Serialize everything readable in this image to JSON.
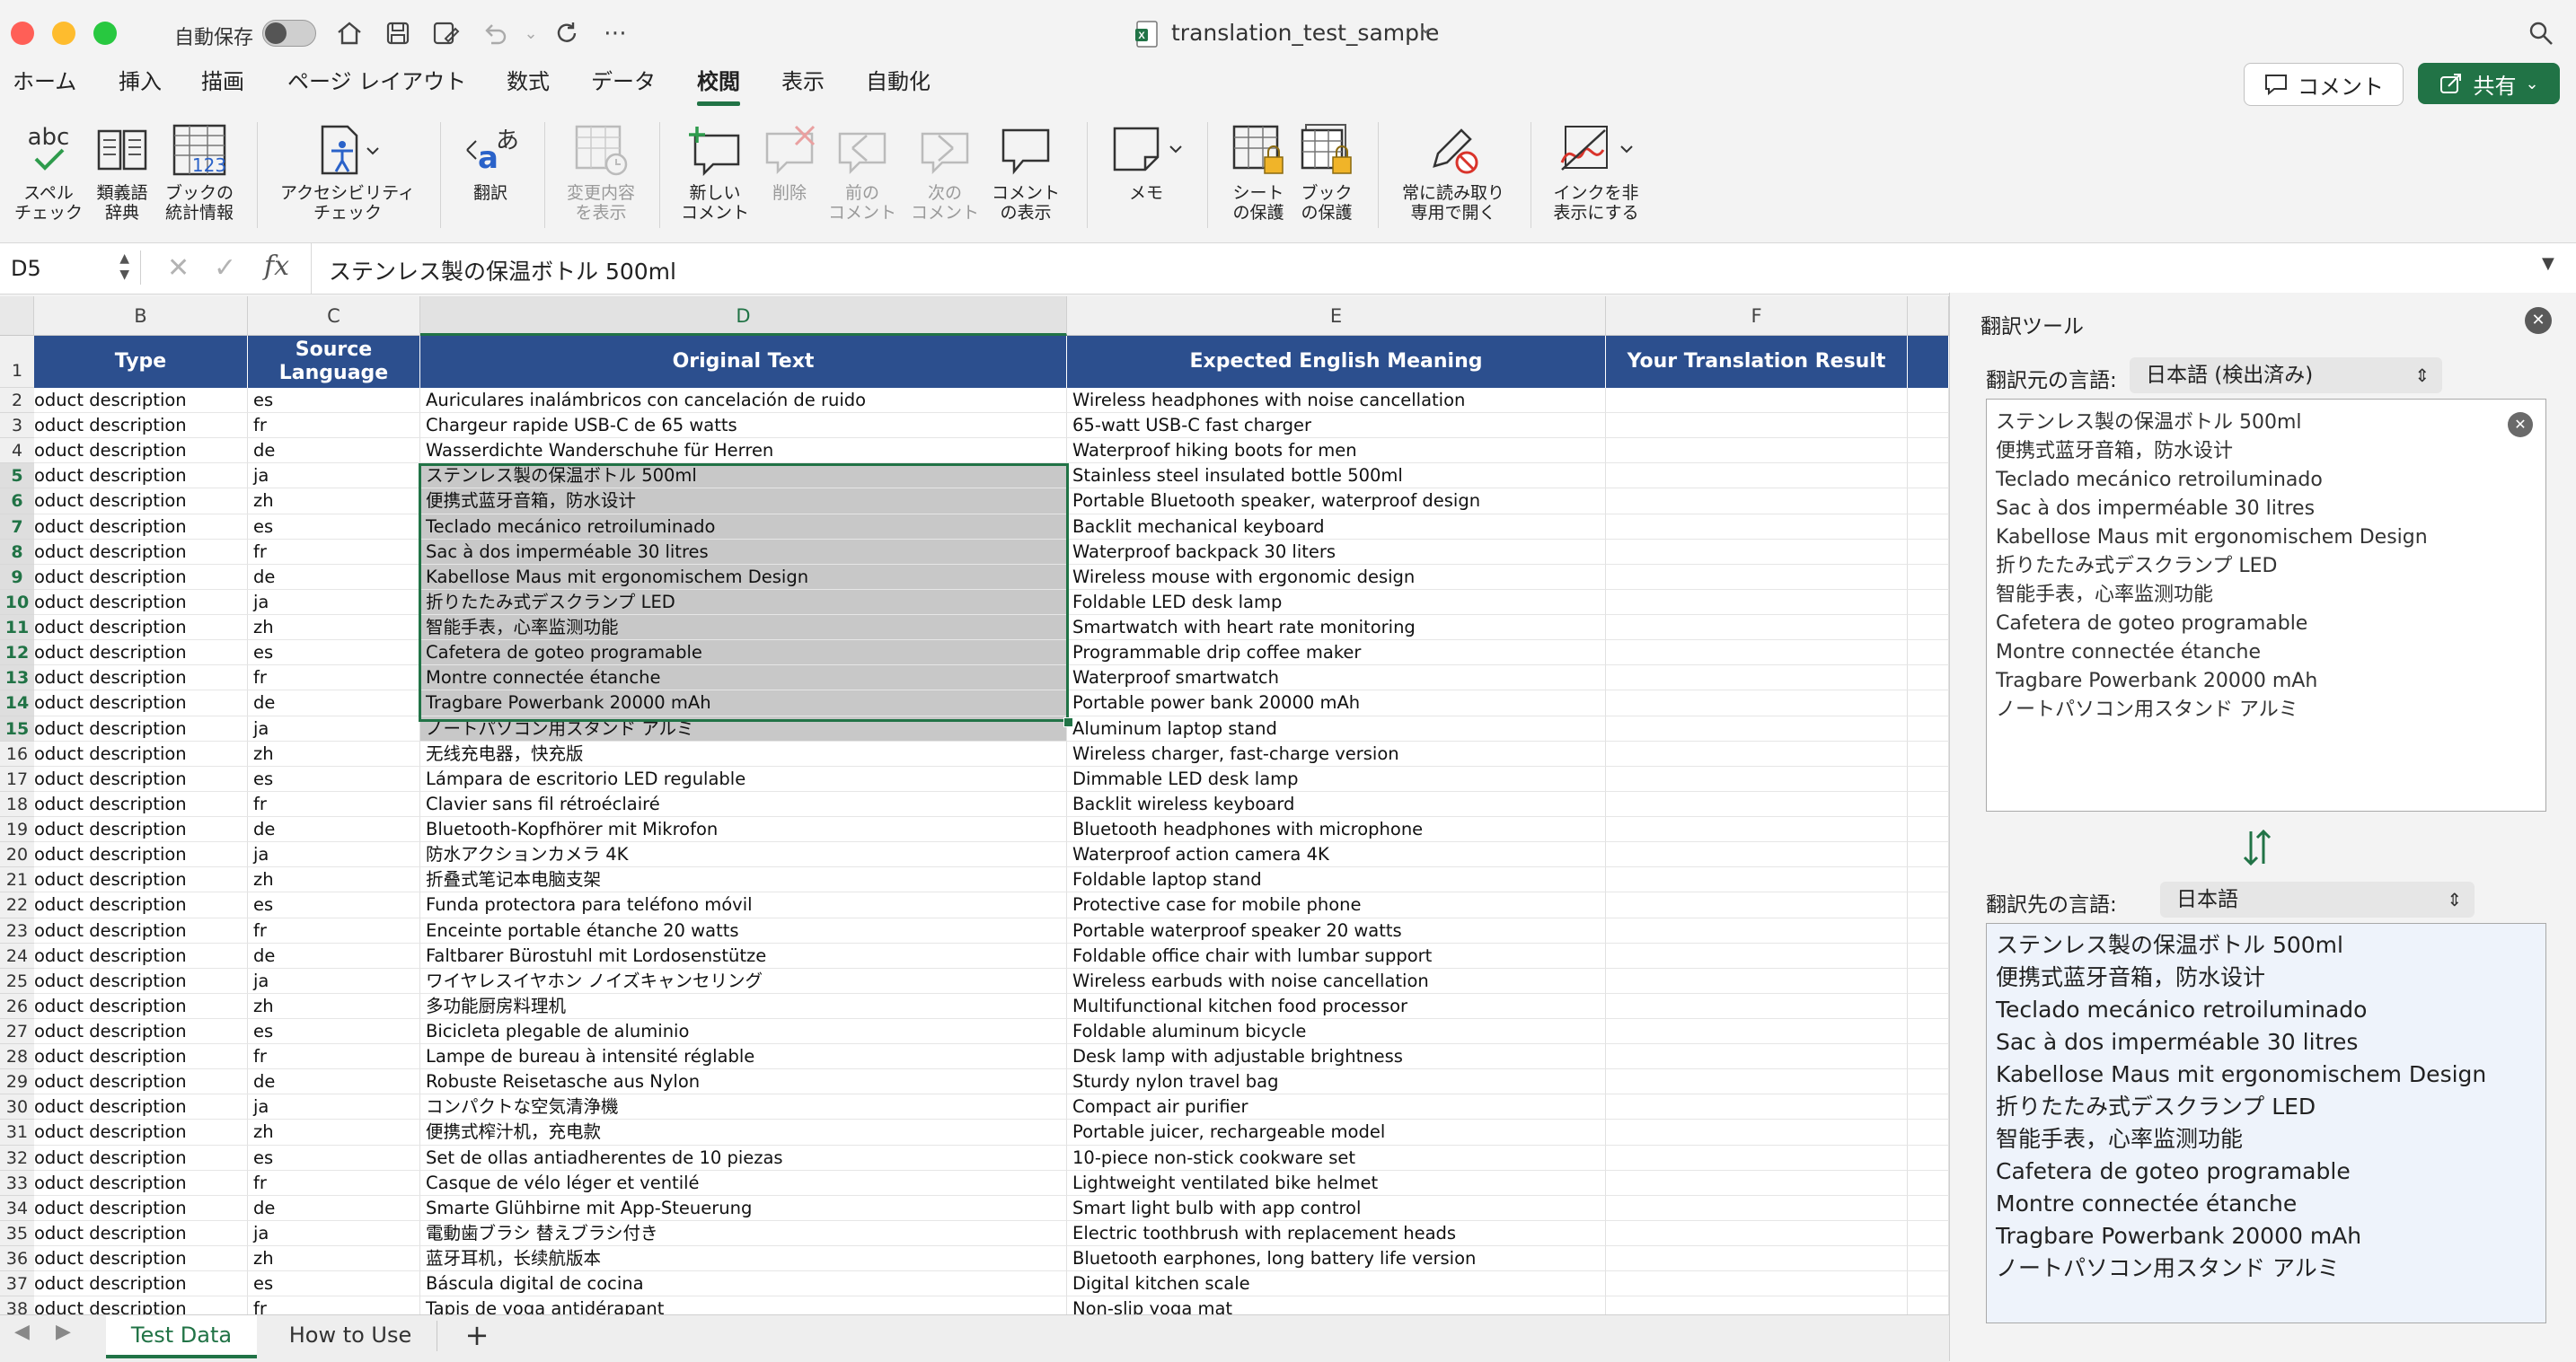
{
  "window": {
    "autosave_label": "自動保存",
    "title": "translation_test_sample"
  },
  "menu": {
    "tabs": [
      "ホーム",
      "挿入",
      "描画",
      "ページ レイアウト",
      "数式",
      "データ",
      "校閲",
      "表示",
      "自動化"
    ],
    "active_index": 6,
    "comment_button": "コメント",
    "share_button": "共有"
  },
  "ribbon": {
    "spell_check": "スペル\nチェック",
    "thesaurus": "類義語\n辞典",
    "workbook_stats": "ブックの\n統計情報",
    "accessibility": "アクセシビリティ\nチェック",
    "translate": "翻訳",
    "show_changes": "変更内容\nを表示",
    "new_comment": "新しい\nコメント",
    "delete": "削除",
    "prev_comment": "前の\nコメント",
    "next_comment": "次の\nコメント",
    "show_comments": "コメント\nの表示",
    "notes": "メモ",
    "protect_sheet": "シート\nの保護",
    "protect_workbook": "ブック\nの保護",
    "always_read_only": "常に読み取り\n専用で開く",
    "hide_ink": "インクを非\n表示にする"
  },
  "formula_bar": {
    "name_box": "D5",
    "fx": "fx",
    "content": "ステンレス製の保温ボトル 500ml"
  },
  "grid": {
    "column_letters": [
      "B",
      "C",
      "D",
      "E",
      "F"
    ],
    "header_row_number": "1",
    "headers": [
      "Type",
      "Source\nLanguage",
      "Original Text",
      "Expected English Meaning",
      "Your Translation Result"
    ],
    "rows": [
      {
        "num": "2",
        "b": "oduct description",
        "c": "es",
        "d": "Auriculares inalámbricos con cancelación de ruido",
        "e": "Wireless headphones with noise cancellation"
      },
      {
        "num": "3",
        "b": "oduct description",
        "c": "fr",
        "d": "Chargeur rapide USB-C de 65 watts",
        "e": "65-watt USB-C fast charger"
      },
      {
        "num": "4",
        "b": "oduct description",
        "c": "de",
        "d": "Wasserdichte Wanderschuhe für Herren",
        "e": "Waterproof hiking boots for men"
      },
      {
        "num": "5",
        "b": "oduct description",
        "c": "ja",
        "d": "ステンレス製の保温ボトル 500ml",
        "e": "Stainless steel insulated bottle 500ml"
      },
      {
        "num": "6",
        "b": "oduct description",
        "c": "zh",
        "d": "便携式蓝牙音箱，防水设计",
        "e": "Portable Bluetooth speaker, waterproof design"
      },
      {
        "num": "7",
        "b": "oduct description",
        "c": "es",
        "d": "Teclado mecánico retroiluminado",
        "e": "Backlit mechanical keyboard"
      },
      {
        "num": "8",
        "b": "oduct description",
        "c": "fr",
        "d": "Sac à dos imperméable 30 litres",
        "e": "Waterproof backpack 30 liters"
      },
      {
        "num": "9",
        "b": "oduct description",
        "c": "de",
        "d": "Kabellose Maus mit ergonomischem Design",
        "e": "Wireless mouse with ergonomic design"
      },
      {
        "num": "10",
        "b": "oduct description",
        "c": "ja",
        "d": "折りたたみ式デスクランプ LED",
        "e": "Foldable LED desk lamp"
      },
      {
        "num": "11",
        "b": "oduct description",
        "c": "zh",
        "d": "智能手表，心率监测功能",
        "e": "Smartwatch with heart rate monitoring"
      },
      {
        "num": "12",
        "b": "oduct description",
        "c": "es",
        "d": "Cafetera de goteo programable",
        "e": "Programmable drip coffee maker"
      },
      {
        "num": "13",
        "b": "oduct description",
        "c": "fr",
        "d": "Montre connectée étanche",
        "e": "Waterproof smartwatch"
      },
      {
        "num": "14",
        "b": "oduct description",
        "c": "de",
        "d": "Tragbare Powerbank 20000 mAh",
        "e": "Portable power bank 20000 mAh"
      },
      {
        "num": "15",
        "b": "oduct description",
        "c": "ja",
        "d": "ノートパソコン用スタンド アルミ",
        "e": "Aluminum laptop stand"
      },
      {
        "num": "16",
        "b": "oduct description",
        "c": "zh",
        "d": "无线充电器，快充版",
        "e": "Wireless charger, fast-charge version"
      },
      {
        "num": "17",
        "b": "oduct description",
        "c": "es",
        "d": "Lámpara de escritorio LED regulable",
        "e": "Dimmable LED desk lamp"
      },
      {
        "num": "18",
        "b": "oduct description",
        "c": "fr",
        "d": "Clavier sans fil rétroéclairé",
        "e": "Backlit wireless keyboard"
      },
      {
        "num": "19",
        "b": "oduct description",
        "c": "de",
        "d": "Bluetooth-Kopfhörer mit Mikrofon",
        "e": "Bluetooth headphones with microphone"
      },
      {
        "num": "20",
        "b": "oduct description",
        "c": "ja",
        "d": "防水アクションカメラ 4K",
        "e": "Waterproof action camera 4K"
      },
      {
        "num": "21",
        "b": "oduct description",
        "c": "zh",
        "d": "折叠式笔记本电脑支架",
        "e": "Foldable laptop stand"
      },
      {
        "num": "22",
        "b": "oduct description",
        "c": "es",
        "d": "Funda protectora para teléfono móvil",
        "e": "Protective case for mobile phone"
      },
      {
        "num": "23",
        "b": "oduct description",
        "c": "fr",
        "d": "Enceinte portable étanche 20 watts",
        "e": "Portable waterproof speaker 20 watts"
      },
      {
        "num": "24",
        "b": "oduct description",
        "c": "de",
        "d": "Faltbarer Bürostuhl mit Lordosenstütze",
        "e": "Foldable office chair with lumbar support"
      },
      {
        "num": "25",
        "b": "oduct description",
        "c": "ja",
        "d": "ワイヤレスイヤホン ノイズキャンセリング",
        "e": "Wireless earbuds with noise cancellation"
      },
      {
        "num": "26",
        "b": "oduct description",
        "c": "zh",
        "d": "多功能厨房料理机",
        "e": "Multifunctional kitchen food processor"
      },
      {
        "num": "27",
        "b": "oduct description",
        "c": "es",
        "d": "Bicicleta plegable de aluminio",
        "e": "Foldable aluminum bicycle"
      },
      {
        "num": "28",
        "b": "oduct description",
        "c": "fr",
        "d": "Lampe de bureau à intensité réglable",
        "e": "Desk lamp with adjustable brightness"
      },
      {
        "num": "29",
        "b": "oduct description",
        "c": "de",
        "d": "Robuste Reisetasche aus Nylon",
        "e": "Sturdy nylon travel bag"
      },
      {
        "num": "30",
        "b": "oduct description",
        "c": "ja",
        "d": "コンパクトな空気清浄機",
        "e": "Compact air purifier"
      },
      {
        "num": "31",
        "b": "oduct description",
        "c": "zh",
        "d": "便携式榨汁机，充电款",
        "e": "Portable juicer, rechargeable model"
      },
      {
        "num": "32",
        "b": "oduct description",
        "c": "es",
        "d": "Set de ollas antiadherentes de 10 piezas",
        "e": "10-piece non-stick cookware set"
      },
      {
        "num": "33",
        "b": "oduct description",
        "c": "fr",
        "d": "Casque de vélo léger et ventilé",
        "e": "Lightweight ventilated bike helmet"
      },
      {
        "num": "34",
        "b": "oduct description",
        "c": "de",
        "d": "Smarte Glühbirne mit App-Steuerung",
        "e": "Smart light bulb with app control"
      },
      {
        "num": "35",
        "b": "oduct description",
        "c": "ja",
        "d": "電動歯ブラシ 替えブラシ付き",
        "e": "Electric toothbrush with replacement heads"
      },
      {
        "num": "36",
        "b": "oduct description",
        "c": "zh",
        "d": "蓝牙耳机，长续航版本",
        "e": "Bluetooth earphones, long battery life version"
      },
      {
        "num": "37",
        "b": "oduct description",
        "c": "es",
        "d": "Báscula digital de cocina",
        "e": "Digital kitchen scale"
      },
      {
        "num": "38",
        "b": "oduct description",
        "c": "fr",
        "d": "Tapis de yoga antidérapant",
        "e": "Non-slip yoga mat"
      }
    ]
  },
  "sheets": {
    "tabs": [
      "Test Data",
      "How to Use"
    ],
    "active_index": 0,
    "add": "+"
  },
  "translate_pane": {
    "title": "翻訳ツール",
    "source_label": "翻訳元の言語:",
    "source_value": "日本語 (検出済み)",
    "target_label": "翻訳先の言語:",
    "target_value": "日本語",
    "source_lines": [
      "ステンレス製の保温ボトル 500ml",
      "便携式蓝牙音箱，防水设计",
      "Teclado mecánico retroiluminado",
      "Sac à dos imperméable 30 litres",
      "Kabellose Maus mit ergonomischem Design",
      "折りたたみ式デスクランプ LED",
      "智能手表，心率监测功能",
      "Cafetera de goteo programable",
      "Montre connectée étanche",
      "Tragbare Powerbank 20000 mAh",
      "ノートパソコン用スタンド アルミ"
    ],
    "target_lines": [
      "ステンレス製の保温ボトル 500ml",
      "便携式蓝牙音箱，防水设计",
      "Teclado mecánico retroiluminado",
      "Sac à dos imperméable 30 litres",
      "Kabellose Maus mit ergonomischem Design",
      "折りたたみ式デスクランプ LED",
      "智能手表，心率监测功能",
      "Cafetera de goteo programable",
      "Montre connectée étanche",
      "Tragbare Powerbank 20000 mAh",
      "ノートパソコン用スタンド アルミ"
    ]
  },
  "colors": {
    "accent_green": "#217346",
    "header_blue": "#2c4f8e",
    "selection_gray": "#c8c8c8",
    "target_box_bg": "#eef3fb"
  }
}
